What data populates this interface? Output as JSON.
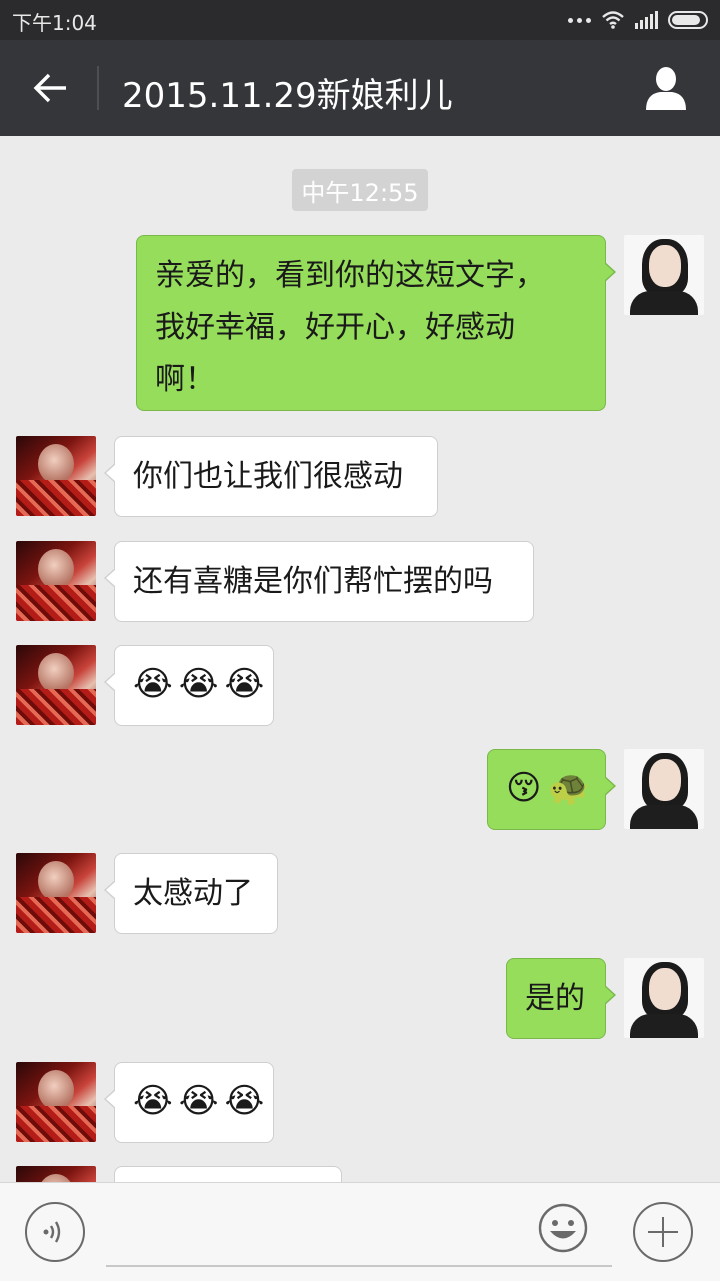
{
  "status_bar": {
    "time": "下午1:04",
    "icons": [
      "more-dots-icon",
      "wifi-icon",
      "signal-icon",
      "battery-icon"
    ]
  },
  "header": {
    "title": "2015.11.29新娘利儿",
    "back_icon": "back-arrow-icon",
    "profile_icon": "profile-icon"
  },
  "chat": {
    "time_label": "中午12:55",
    "messages": [
      {
        "side": "right",
        "lines": [
          "亲爱的，看到你的这短文字，",
          "我好幸福，好开心，好感动",
          "啊！"
        ]
      },
      {
        "side": "left",
        "text": "你们也让我们很感动"
      },
      {
        "side": "left",
        "text": "还有喜糖是你们帮忙摆的吗"
      },
      {
        "side": "left",
        "emojis": [
          "😭",
          "😭",
          "😭"
        ]
      },
      {
        "side": "right",
        "emojis": [
          "😚",
          "🐢"
        ]
      },
      {
        "side": "left",
        "text": "太感动了"
      },
      {
        "side": "right",
        "text": "是的"
      },
      {
        "side": "left",
        "emojis": [
          "😭",
          "😭",
          "😭"
        ]
      }
    ]
  },
  "input_bar": {
    "voice_icon": "voice-icon",
    "text_value": "",
    "emoji_icon": "emoji-face-icon",
    "plus_icon": "plus-icon"
  },
  "colors": {
    "status_bar_bg": "#2b2b2d",
    "title_bar_bg": "#34363a",
    "chat_bg": "#ebebeb",
    "sent_bubble": "#95dd5b",
    "received_bubble": "#ffffff",
    "time_badge_bg": "#d3d3d3"
  }
}
